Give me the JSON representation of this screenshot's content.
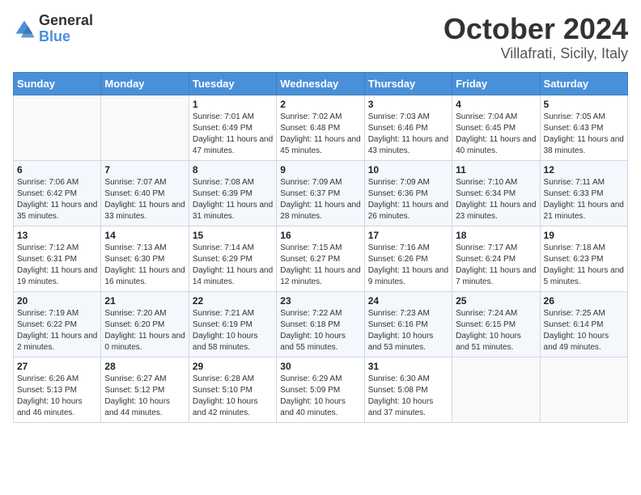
{
  "header": {
    "logo_general": "General",
    "logo_blue": "Blue",
    "title": "October 2024",
    "subtitle": "Villafrati, Sicily, Italy"
  },
  "days_of_week": [
    "Sunday",
    "Monday",
    "Tuesday",
    "Wednesday",
    "Thursday",
    "Friday",
    "Saturday"
  ],
  "weeks": [
    [
      {
        "day": "",
        "sunrise": "",
        "sunset": "",
        "daylight": ""
      },
      {
        "day": "",
        "sunrise": "",
        "sunset": "",
        "daylight": ""
      },
      {
        "day": "1",
        "sunrise": "Sunrise: 7:01 AM",
        "sunset": "Sunset: 6:49 PM",
        "daylight": "Daylight: 11 hours and 47 minutes."
      },
      {
        "day": "2",
        "sunrise": "Sunrise: 7:02 AM",
        "sunset": "Sunset: 6:48 PM",
        "daylight": "Daylight: 11 hours and 45 minutes."
      },
      {
        "day": "3",
        "sunrise": "Sunrise: 7:03 AM",
        "sunset": "Sunset: 6:46 PM",
        "daylight": "Daylight: 11 hours and 43 minutes."
      },
      {
        "day": "4",
        "sunrise": "Sunrise: 7:04 AM",
        "sunset": "Sunset: 6:45 PM",
        "daylight": "Daylight: 11 hours and 40 minutes."
      },
      {
        "day": "5",
        "sunrise": "Sunrise: 7:05 AM",
        "sunset": "Sunset: 6:43 PM",
        "daylight": "Daylight: 11 hours and 38 minutes."
      }
    ],
    [
      {
        "day": "6",
        "sunrise": "Sunrise: 7:06 AM",
        "sunset": "Sunset: 6:42 PM",
        "daylight": "Daylight: 11 hours and 35 minutes."
      },
      {
        "day": "7",
        "sunrise": "Sunrise: 7:07 AM",
        "sunset": "Sunset: 6:40 PM",
        "daylight": "Daylight: 11 hours and 33 minutes."
      },
      {
        "day": "8",
        "sunrise": "Sunrise: 7:08 AM",
        "sunset": "Sunset: 6:39 PM",
        "daylight": "Daylight: 11 hours and 31 minutes."
      },
      {
        "day": "9",
        "sunrise": "Sunrise: 7:09 AM",
        "sunset": "Sunset: 6:37 PM",
        "daylight": "Daylight: 11 hours and 28 minutes."
      },
      {
        "day": "10",
        "sunrise": "Sunrise: 7:09 AM",
        "sunset": "Sunset: 6:36 PM",
        "daylight": "Daylight: 11 hours and 26 minutes."
      },
      {
        "day": "11",
        "sunrise": "Sunrise: 7:10 AM",
        "sunset": "Sunset: 6:34 PM",
        "daylight": "Daylight: 11 hours and 23 minutes."
      },
      {
        "day": "12",
        "sunrise": "Sunrise: 7:11 AM",
        "sunset": "Sunset: 6:33 PM",
        "daylight": "Daylight: 11 hours and 21 minutes."
      }
    ],
    [
      {
        "day": "13",
        "sunrise": "Sunrise: 7:12 AM",
        "sunset": "Sunset: 6:31 PM",
        "daylight": "Daylight: 11 hours and 19 minutes."
      },
      {
        "day": "14",
        "sunrise": "Sunrise: 7:13 AM",
        "sunset": "Sunset: 6:30 PM",
        "daylight": "Daylight: 11 hours and 16 minutes."
      },
      {
        "day": "15",
        "sunrise": "Sunrise: 7:14 AM",
        "sunset": "Sunset: 6:29 PM",
        "daylight": "Daylight: 11 hours and 14 minutes."
      },
      {
        "day": "16",
        "sunrise": "Sunrise: 7:15 AM",
        "sunset": "Sunset: 6:27 PM",
        "daylight": "Daylight: 11 hours and 12 minutes."
      },
      {
        "day": "17",
        "sunrise": "Sunrise: 7:16 AM",
        "sunset": "Sunset: 6:26 PM",
        "daylight": "Daylight: 11 hours and 9 minutes."
      },
      {
        "day": "18",
        "sunrise": "Sunrise: 7:17 AM",
        "sunset": "Sunset: 6:24 PM",
        "daylight": "Daylight: 11 hours and 7 minutes."
      },
      {
        "day": "19",
        "sunrise": "Sunrise: 7:18 AM",
        "sunset": "Sunset: 6:23 PM",
        "daylight": "Daylight: 11 hours and 5 minutes."
      }
    ],
    [
      {
        "day": "20",
        "sunrise": "Sunrise: 7:19 AM",
        "sunset": "Sunset: 6:22 PM",
        "daylight": "Daylight: 11 hours and 2 minutes."
      },
      {
        "day": "21",
        "sunrise": "Sunrise: 7:20 AM",
        "sunset": "Sunset: 6:20 PM",
        "daylight": "Daylight: 11 hours and 0 minutes."
      },
      {
        "day": "22",
        "sunrise": "Sunrise: 7:21 AM",
        "sunset": "Sunset: 6:19 PM",
        "daylight": "Daylight: 10 hours and 58 minutes."
      },
      {
        "day": "23",
        "sunrise": "Sunrise: 7:22 AM",
        "sunset": "Sunset: 6:18 PM",
        "daylight": "Daylight: 10 hours and 55 minutes."
      },
      {
        "day": "24",
        "sunrise": "Sunrise: 7:23 AM",
        "sunset": "Sunset: 6:16 PM",
        "daylight": "Daylight: 10 hours and 53 minutes."
      },
      {
        "day": "25",
        "sunrise": "Sunrise: 7:24 AM",
        "sunset": "Sunset: 6:15 PM",
        "daylight": "Daylight: 10 hours and 51 minutes."
      },
      {
        "day": "26",
        "sunrise": "Sunrise: 7:25 AM",
        "sunset": "Sunset: 6:14 PM",
        "daylight": "Daylight: 10 hours and 49 minutes."
      }
    ],
    [
      {
        "day": "27",
        "sunrise": "Sunrise: 6:26 AM",
        "sunset": "Sunset: 5:13 PM",
        "daylight": "Daylight: 10 hours and 46 minutes."
      },
      {
        "day": "28",
        "sunrise": "Sunrise: 6:27 AM",
        "sunset": "Sunset: 5:12 PM",
        "daylight": "Daylight: 10 hours and 44 minutes."
      },
      {
        "day": "29",
        "sunrise": "Sunrise: 6:28 AM",
        "sunset": "Sunset: 5:10 PM",
        "daylight": "Daylight: 10 hours and 42 minutes."
      },
      {
        "day": "30",
        "sunrise": "Sunrise: 6:29 AM",
        "sunset": "Sunset: 5:09 PM",
        "daylight": "Daylight: 10 hours and 40 minutes."
      },
      {
        "day": "31",
        "sunrise": "Sunrise: 6:30 AM",
        "sunset": "Sunset: 5:08 PM",
        "daylight": "Daylight: 10 hours and 37 minutes."
      },
      {
        "day": "",
        "sunrise": "",
        "sunset": "",
        "daylight": ""
      },
      {
        "day": "",
        "sunrise": "",
        "sunset": "",
        "daylight": ""
      }
    ]
  ]
}
